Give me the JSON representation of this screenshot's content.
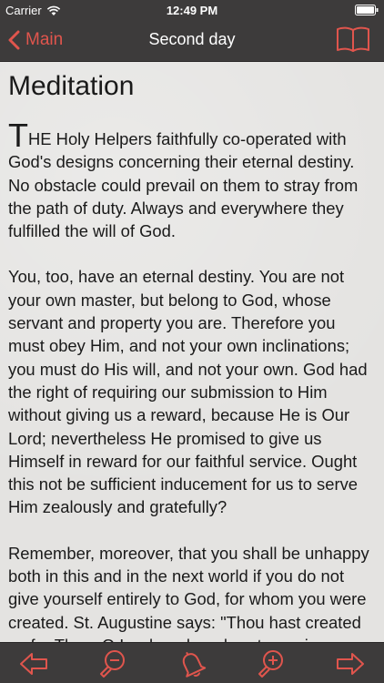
{
  "status_bar": {
    "carrier": "Carrier",
    "time": "12:49 PM"
  },
  "nav": {
    "back_label": "Main",
    "title": "Second day"
  },
  "article": {
    "heading": "Meditation",
    "first_letter": "T",
    "paragraphs": [
      "HE Holy Helpers faithfully co-operated with God's designs concerning their eternal destiny. No obstacle could prevail on them to stray from the path of duty. Always and everywhere they fulfilled the will of God.",
      "You, too, have an eternal destiny. You are not your own master, but belong to God, whose servant and property you are. Therefore you must obey Him, and not your own inclinations; you must do His will, and not your own. God had the right of requiring our submission to Him without giving us a reward, because He is Our Lord; nevertheless He promised to give us Himself in reward for our faithful service. Ought this not be sufficient inducement for us to serve Him zealously and gratefully?",
      "Remember, moreover, that you shall be unhappy both in this and in the next world if you do not give yourself entirely to God, for whom you were created. St. Augustine says: \"Thou hast created us for Thee, O Lord, and our heart remains"
    ]
  },
  "toolbar": {
    "items": [
      "prev-arrow-icon",
      "zoom-out-icon",
      "bell-icon",
      "zoom-in-icon",
      "next-arrow-icon"
    ]
  },
  "colors": {
    "accent": "#e0554d",
    "bar_background": "#3d3b3b",
    "page_background": "#e4e3e1",
    "text": "#1a1a1a"
  }
}
